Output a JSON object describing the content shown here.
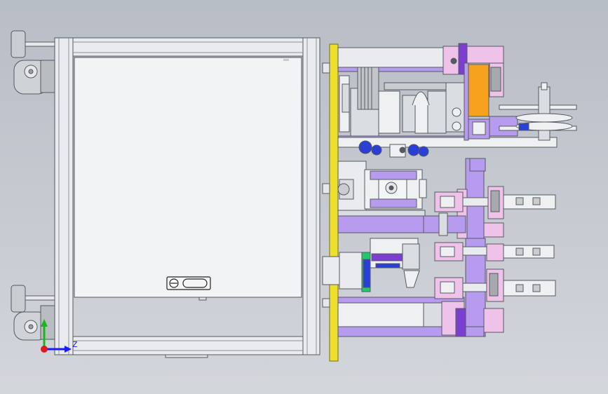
{
  "view": {
    "triad": {
      "z_label": "Z"
    },
    "colors": {
      "background_top": "#b8bdc6",
      "background_bottom": "#d3d6db",
      "frame": "#e9ebee",
      "frame_edge": "#555a60",
      "mount_plate": "#ecdf2e",
      "purple_block": "#b79bee",
      "purple_dark": "#7b3fcf",
      "pink_block": "#efc2ea",
      "orange_block": "#f6a21e",
      "blue_part": "#2a3fd6",
      "green_part": "#22c96b",
      "metal": "#dadde1",
      "axis_x": "#e01a1a",
      "axis_y": "#17b917",
      "axis_z": "#1a1aff"
    },
    "icons": [
      "leveling-foot-icon",
      "caster-wheel-icon",
      "handle-icon",
      "coordinate-triad-icon"
    ]
  }
}
